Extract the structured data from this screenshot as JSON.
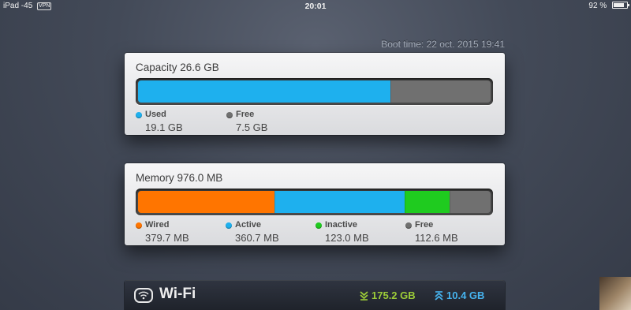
{
  "status_bar": {
    "device": "iPad",
    "signal": "-45",
    "vpn": "VPN",
    "time": "20:01",
    "battery": "92 %",
    "battery_level": 0.92
  },
  "boot_time": "Boot time: 22 oct. 2015 19:41",
  "capacity": {
    "title": "Capacity 26.6 GB",
    "segments": [
      {
        "label": "Used",
        "value": "19.1 GB",
        "amount": 19.1,
        "color": "#1eb0ee"
      },
      {
        "label": "Free",
        "value": "7.5 GB",
        "amount": 7.5,
        "color": "#707070"
      }
    ]
  },
  "memory": {
    "title": "Memory 976.0 MB",
    "segments": [
      {
        "label": "Wired",
        "value": "379.7 MB",
        "amount": 379.7,
        "color": "#ff7500"
      },
      {
        "label": "Active",
        "value": "360.7 MB",
        "amount": 360.7,
        "color": "#1eb0ee"
      },
      {
        "label": "Inactive",
        "value": "123.0 MB",
        "amount": 123.0,
        "color": "#1fcb1f"
      },
      {
        "label": "Free",
        "value": "112.6 MB",
        "amount": 112.6,
        "color": "#707070"
      }
    ]
  },
  "wifi": {
    "icon_text": "wifi",
    "title": "Wi-Fi",
    "download": "175.2 GB",
    "upload": "10.4 GB",
    "download_color": "#9ccc38",
    "upload_color": "#46b3ee"
  }
}
